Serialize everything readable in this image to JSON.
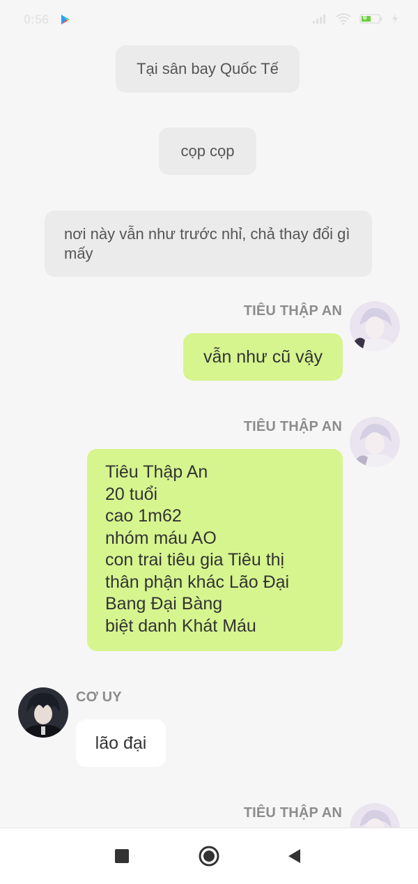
{
  "status": {
    "time": "0:56",
    "battery_level": "6",
    "icons": [
      "play-store-icon",
      "signal-icon",
      "wifi-icon",
      "battery-icon",
      "charging-icon"
    ]
  },
  "narrations": [
    "Tại sân bay Quốc Tế",
    "cọp cọp",
    "nơi này vẫn như trước nhỉ, chả thay đổi gì mấy"
  ],
  "messages": [
    {
      "side": "right",
      "sender": "TIÊU THẬP AN",
      "lines": [
        "vẫn như cũ vậy"
      ]
    },
    {
      "side": "right",
      "sender": "TIÊU THẬP AN",
      "lines": [
        "Tiêu Thập An",
        "20 tuổi",
        "cao 1m62",
        "nhóm máu AO",
        "con trai tiêu gia Tiêu thị",
        "thân phận khác Lão Đại",
        "Bang Đại Bàng",
        "biệt danh Khát Máu"
      ]
    },
    {
      "side": "left",
      "sender": "CƠ UY",
      "lines": [
        "lão đại"
      ]
    },
    {
      "side": "right",
      "sender": "TIÊU THẬP AN",
      "lines": []
    }
  ],
  "colors": {
    "background": "#f6f6f6",
    "narration_bubble": "#ebebeb",
    "own_bubble": "#d6f58f",
    "other_bubble": "#ffffff",
    "sender_name": "#8c8c8c"
  },
  "nav": {
    "icons": [
      "recent-apps-icon",
      "home-icon",
      "back-icon"
    ]
  }
}
